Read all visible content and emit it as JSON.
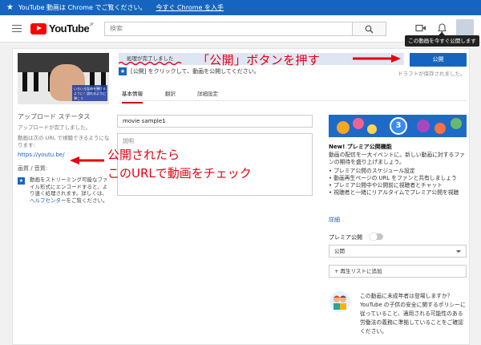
{
  "infobar": {
    "message": "YouTube 動画は Chrome でご覧ください。",
    "link": "今すぐ Chrome を入手"
  },
  "header": {
    "logo_text": "YouTube",
    "logo_region": "JP",
    "search_placeholder": "検索",
    "tooltip": "この動画を今すぐ公開します"
  },
  "upload": {
    "status_message": "処理が完了しました",
    "publish_button": "公開",
    "instruction": "[公開] をクリックして、動画を公開してください。",
    "draft_saved": "ドラフトが保存されました。",
    "tabs": [
      "基本情報",
      "翻訳",
      "詳細設定"
    ],
    "title_value": "movie sample1",
    "description_placeholder": "説明",
    "thumbnail_caption": "いろいろな曲を弾けるように！流れるように弾こう"
  },
  "left_panel": {
    "upload_status_title": "アップロード ステータス",
    "upload_done": "アップロードが完了しました。",
    "url_note": "動画は次の URL で視聴できるようになります:",
    "url": "https://youtu.be/",
    "quality_title": "画質 / 音質:",
    "quality_text_1": "動画をストリーミング可能なファイル形式にエンコードすると、より速く処理されます。詳しくは、",
    "quality_link": "ヘルプセンター",
    "quality_text_2": "をご覧ください。"
  },
  "premiere_panel": {
    "badge_number": "3",
    "title": "New! プレミア公開機能",
    "body": "動画の配信を一大イベントに。新しい動画に対するファンの期待を盛り上げましょう。",
    "list": [
      "• プレミア公開のスケジュール設定",
      "• 動画再生ページの URL をファンと共有しましょう",
      "• プレミア公開中や公開前に視聴者とチャット",
      "• 視聴者と一緒にリアルタイムでプレミア公開を視聴"
    ],
    "more_link": "詳細",
    "premiere_toggle_label": "プレミア公開",
    "visibility_value": "公開",
    "add_playlist": "+ 再生リストに追加",
    "kids_text": "この動画に未成年者は登場しますか？ YouTube の子供の安全に関するポリシーに従っていること、適用される可能性のある労働法の義務に準拠していることをご確認ください。"
  },
  "annotations": {
    "publish_callout": "「公開」ボタンを押す",
    "url_callout_line1": "公開されたら",
    "url_callout_line2": "このURLで動画をチェック"
  },
  "colors": {
    "accent_blue": "#1565c0",
    "annotation_red": "#e60012",
    "youtube_red": "#ff0000"
  }
}
